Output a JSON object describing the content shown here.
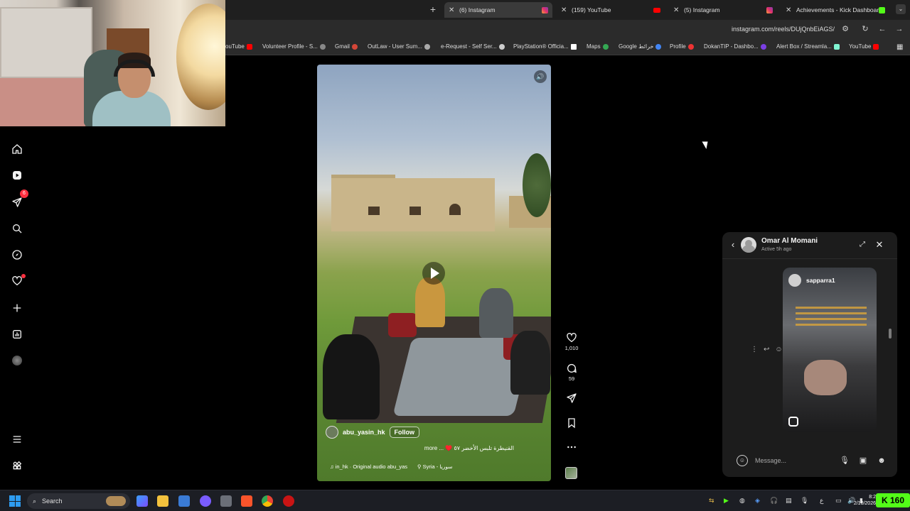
{
  "browser": {
    "tabs": [
      {
        "label": "(6) Instagram",
        "favicon": "instagram-icon",
        "active": true
      },
      {
        "label": "(159) YouTube",
        "favicon": "youtube-icon",
        "active": false
      },
      {
        "label": "(5) Instagram",
        "favicon": "instagram-icon",
        "active": false
      },
      {
        "label": "Achievements - Kick Dashboard",
        "favicon": "kick-icon",
        "active": false
      }
    ],
    "url": "instagram.com/reels/DUjQnbEiAGS/",
    "bookmarks": [
      "ouTube",
      "Volunteer Profile - S...",
      "Gmail",
      "OutLaw - User Sum...",
      "e-Request - Self Ser...",
      "PlayStation® Officia...",
      "Maps",
      "Google خرائط",
      "Profile",
      "DokanTIP - Dashbo...",
      "Alert Box / Streamla...",
      "YouTube"
    ]
  },
  "sidebar": {
    "items": [
      {
        "name": "home",
        "icon": "home-icon"
      },
      {
        "name": "reels",
        "icon": "reels-icon"
      },
      {
        "name": "messages",
        "icon": "send-icon",
        "badge": "6"
      },
      {
        "name": "search",
        "icon": "search-icon"
      },
      {
        "name": "explore",
        "icon": "compass-icon"
      },
      {
        "name": "notifications",
        "icon": "heart-icon"
      },
      {
        "name": "create",
        "icon": "plus-icon"
      },
      {
        "name": "dashboard",
        "icon": "chart-icon"
      },
      {
        "name": "profile",
        "icon": "avatar-icon"
      }
    ],
    "bottom": [
      {
        "name": "more",
        "icon": "menu-icon"
      },
      {
        "name": "also-from-meta",
        "icon": "apps-icon"
      }
    ]
  },
  "reel": {
    "author": "abu_yasin_hk",
    "follow_label": "Follow",
    "caption": "more ... ♥️ القنيطرة تلبس الأخضر ٥٧",
    "audio": "in_hk · Original audio",
    "audio_tail": "abu_yas",
    "location": "Syria - سوريا",
    "likes": "1,010",
    "comments": "59"
  },
  "chat": {
    "name": "Omar Al Momani",
    "status": "Active 5h ago",
    "shared_username": "sapparra1",
    "input_placeholder": "Message..."
  },
  "taskbar": {
    "search_label": "Search",
    "time": "8:2",
    "date": "2/10/2026",
    "overlay_count": "160",
    "tray_lang": "ع"
  },
  "colors": {
    "accent_kick": "#53fc18",
    "badge_red": "#ff3040",
    "chat_bg": "#1c1c1c",
    "page_bg": "#000000"
  }
}
